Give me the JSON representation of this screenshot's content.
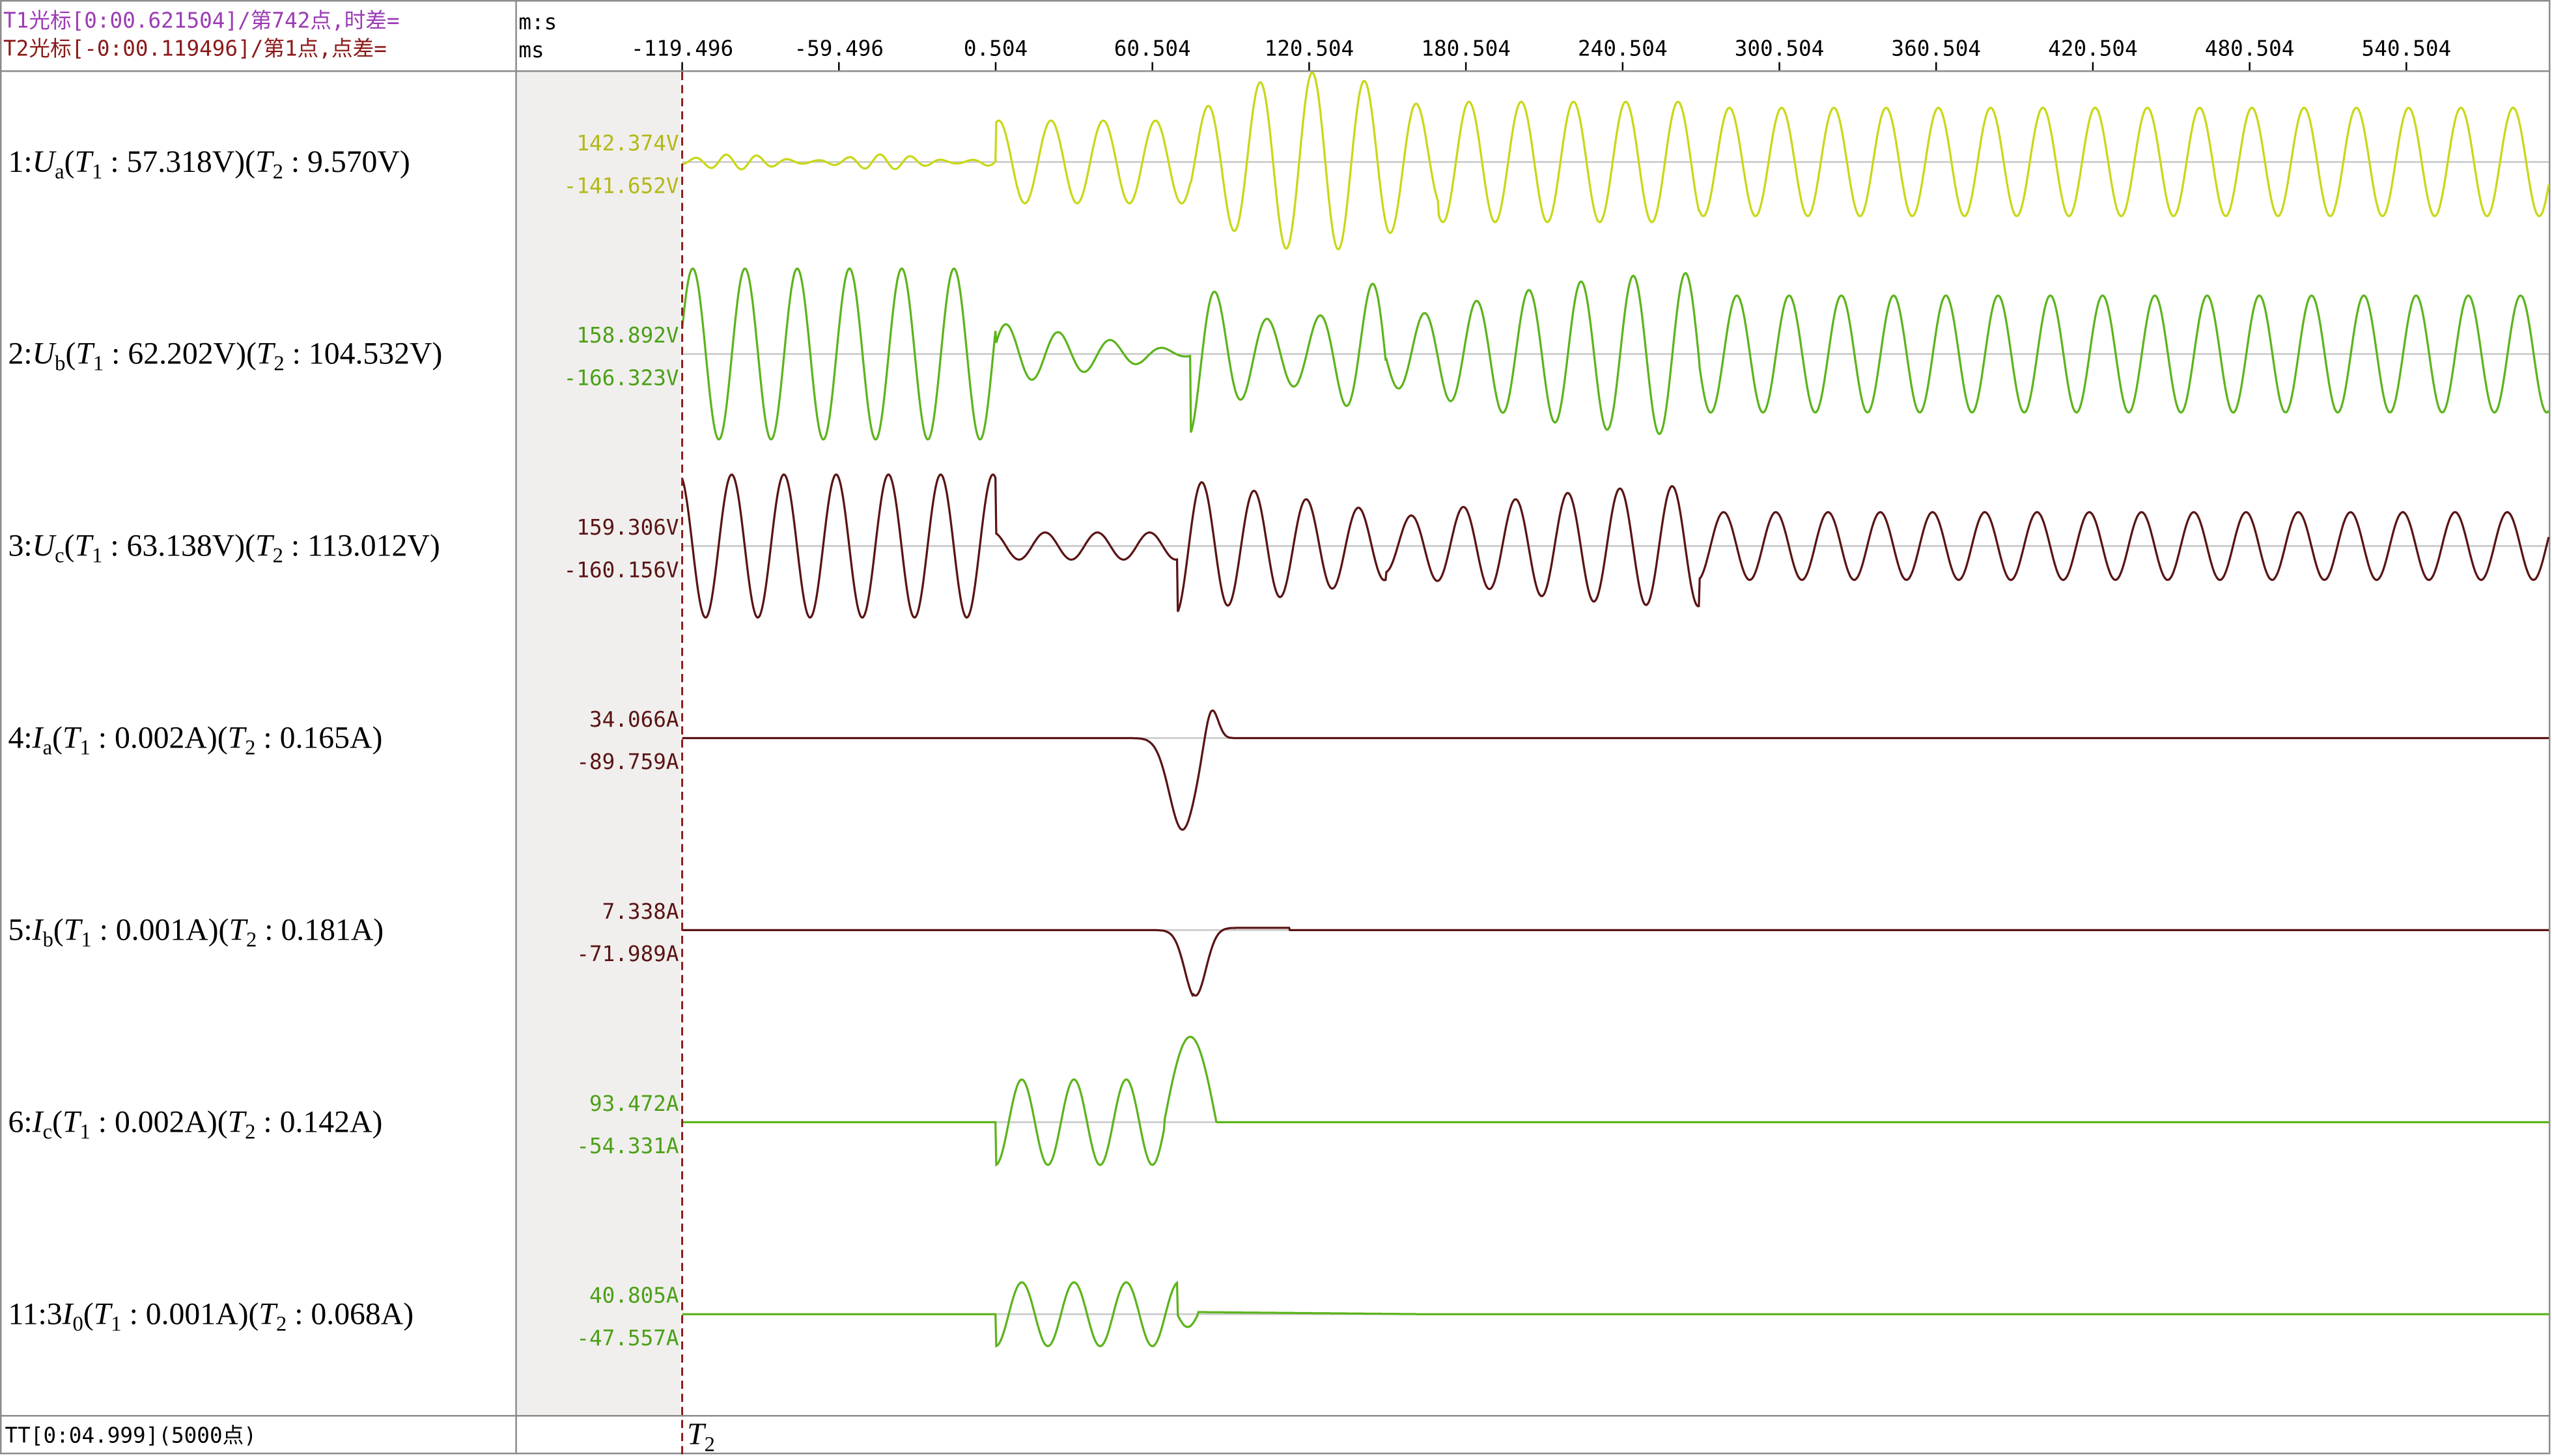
{
  "header": {
    "t1_info": "T1光标[0:00.621504]/第742点,时差=",
    "t2_info": "T2光标[-0:00.119496]/第1点,点差=",
    "time_unit": "m:s",
    "delta_unit": "ms"
  },
  "footer": {
    "total": "TT[0:04.999](5000点)"
  },
  "colors": {
    "ua": "#c8d818",
    "ub": "#5cb41c",
    "uc": "#5a1414",
    "ia": "#5a1414",
    "ib": "#5a1414",
    "ic": "#5cb41c",
    "i0": "#5cb41c",
    "cursor_t1": "#9c3cb4",
    "cursor_t2": "#8b1a1a",
    "label_yellow": "#b4b818",
    "label_green": "#4ca018",
    "label_dark": "#5a1414"
  },
  "cursors": {
    "t1_ms": 621.504,
    "t2_ms": -119.496
  },
  "chart_data": {
    "type": "line",
    "x_axis": {
      "ticks": [
        "-119.496",
        "-59.496",
        "0.504",
        "60.504",
        "120.504",
        "180.504",
        "240.504",
        "300.504",
        "360.504",
        "420.504",
        "480.504",
        "540.504"
      ],
      "range_ms": [
        -119.496,
        595
      ]
    },
    "channels": [
      {
        "id": "ua",
        "prefix": "1:",
        "sym": "U",
        "sub": "a",
        "t1": "57.318V",
        "t2": "9.570V",
        "max": "142.374V",
        "min": "-141.652V",
        "color_key": "ua",
        "label_color": "label_yellow",
        "peak": 142.374
      },
      {
        "id": "ub",
        "prefix": "2:",
        "sym": "U",
        "sub": "b",
        "t1": "62.202V",
        "t2": "104.532V",
        "max": "158.892V",
        "min": "-166.323V",
        "color_key": "ub",
        "label_color": "label_green",
        "peak": 166.323
      },
      {
        "id": "uc",
        "prefix": "3:",
        "sym": "U",
        "sub": "c",
        "t1": "63.138V",
        "t2": "113.012V",
        "max": "159.306V",
        "min": "-160.156V",
        "color_key": "uc",
        "label_color": "label_dark",
        "peak": 160.156
      },
      {
        "id": "ia",
        "prefix": "4:",
        "sym": "I",
        "sub": "a",
        "t1": "0.002A",
        "t2": "0.165A",
        "max": "34.066A",
        "min": "-89.759A",
        "color_key": "ia",
        "label_color": "label_dark",
        "peak": 89.759
      },
      {
        "id": "ib",
        "prefix": "5:",
        "sym": "I",
        "sub": "b",
        "t1": "0.001A",
        "t2": "0.181A",
        "max": "7.338A",
        "min": "-71.989A",
        "color_key": "ib",
        "label_color": "label_dark",
        "peak": 71.989
      },
      {
        "id": "ic",
        "prefix": "6:",
        "sym": "I",
        "sub": "c",
        "t1": "0.002A",
        "t2": "0.142A",
        "max": "93.472A",
        "min": "-54.331A",
        "color_key": "ic",
        "label_color": "label_green",
        "peak": 93.472
      },
      {
        "id": "i0",
        "prefix": "11:3",
        "sym": "I",
        "sub": "0",
        "t1": "0.001A",
        "t2": "0.068A",
        "max": "40.805A",
        "min": "-47.557A",
        "color_key": "i0",
        "label_color": "label_green",
        "peak": 47.557
      }
    ],
    "cursor_labels": {
      "t1": "T",
      "t1_sub": "1",
      "t2": "T",
      "t2_sub": "2",
      "t_prefix": "T",
      "t1_idx": "1",
      "t2_idx": "2"
    }
  }
}
